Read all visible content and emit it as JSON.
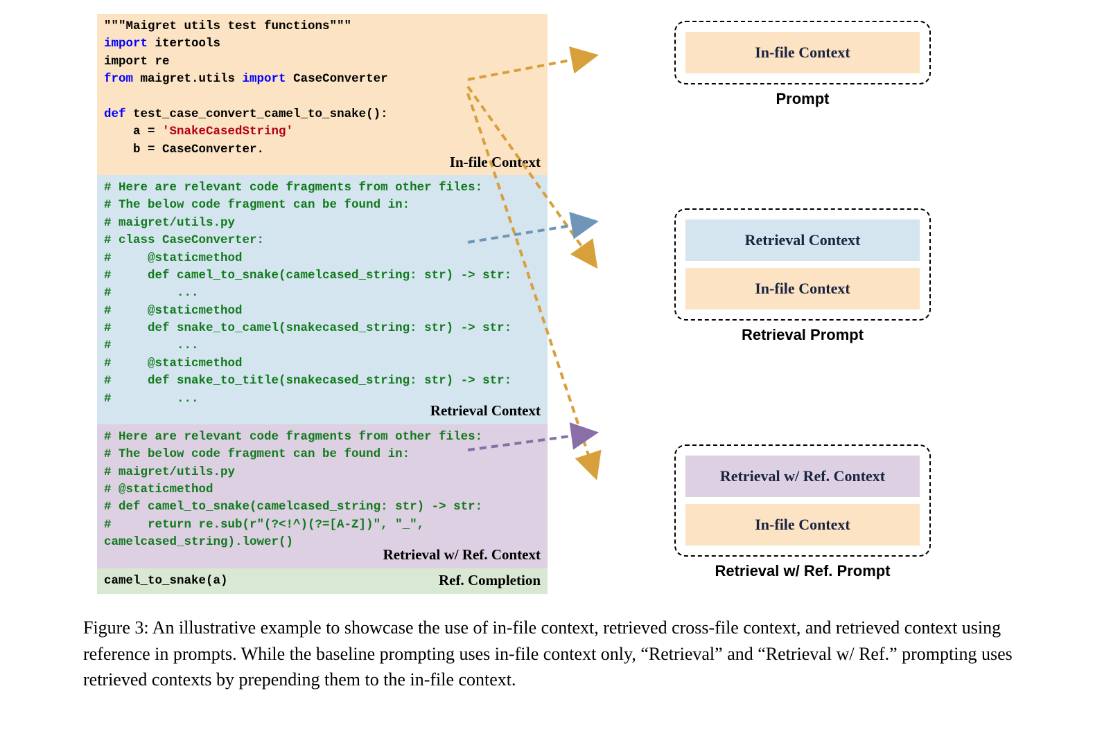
{
  "code": {
    "infile": {
      "label": "In-file Context",
      "l1a": "\"\"\"Maigret utils test functions\"\"\"",
      "l2a": "import",
      "l2b": " itertools",
      "l3a": "import re",
      "l4a": "from",
      "l4b": " maigret.utils ",
      "l4c": "import",
      "l4d": " CaseConverter",
      "l5": "",
      "l6a": "def",
      "l6b": " test_case_convert_camel_to_snake():",
      "l7a": "    a = ",
      "l7b": "'SnakeCasedString'",
      "l8a": "    b = CaseConverter."
    },
    "retrieval": {
      "label": "Retrieval Context",
      "l1": "# Here are relevant code fragments from other files:",
      "l2": "# The below code fragment can be found in:",
      "l3": "# maigret/utils.py",
      "l4": "# class CaseConverter:",
      "l5": "#     @staticmethod",
      "l6": "#     def camel_to_snake(camelcased_string: str) -> str:",
      "l7": "#         ...",
      "l8": "#     @staticmethod",
      "l9": "#     def snake_to_camel(snakecased_string: str) -> str:",
      "l10": "#         ...",
      "l11": "#     @staticmethod",
      "l12": "#     def snake_to_title(snakecased_string: str) -> str:",
      "l13": "#         ..."
    },
    "retrievalref": {
      "label": "Retrieval w/ Ref. Context",
      "l1": "# Here are relevant code fragments from other files:",
      "l2": "# The below code fragment can be found in:",
      "l3": "# maigret/utils.py",
      "l4": "# @staticmethod",
      "l5": "# def camel_to_snake(camelcased_string: str) -> str:",
      "l6": "#     return re.sub(r\"(?<!^)(?=[A-Z])\", \"_\",",
      "l7": "camelcased_string).lower()"
    },
    "completion": {
      "label": "Ref. Completion",
      "l1": "camel_to_snake(a)"
    }
  },
  "prompts": {
    "p1": {
      "bar1": "In-file Context",
      "caption": "Prompt"
    },
    "p2": {
      "bar1": "Retrieval Context",
      "bar2": "In-file Context",
      "caption": "Retrieval Prompt"
    },
    "p3": {
      "bar1": "Retrieval w/ Ref. Context",
      "bar2": "In-file Context",
      "caption": "Retrieval w/ Ref. Prompt"
    }
  },
  "caption": "Figure 3: An illustrative example to showcase the use of in-file context, retrieved cross-file context, and retrieved context using reference in prompts. While the baseline prompting uses in-file context only, “Retrieval” and “Retrieval w/ Ref.” prompting uses retrieved contexts by prepending them to the in-file context."
}
